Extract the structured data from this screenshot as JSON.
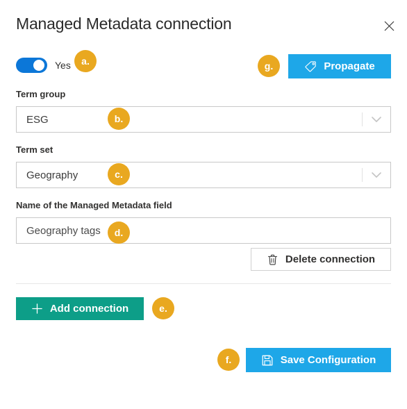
{
  "header": {
    "title": "Managed Metadata connection",
    "close_icon": "close-icon"
  },
  "enabled_toggle": {
    "label": "Yes",
    "state": "on",
    "accent_color": "#0c77d8"
  },
  "propagate_button": {
    "label": "Propagate",
    "icon": "tag-icon",
    "color": "#1ea7e8"
  },
  "fields": {
    "term_group": {
      "label": "Term group",
      "value": "ESG",
      "chevron_icon": "chevron-down-icon"
    },
    "term_set": {
      "label": "Term set",
      "value": "Geography",
      "chevron_icon": "chevron-down-icon"
    },
    "field_name": {
      "label": "Name of the Managed Metadata field",
      "value": "Geography tags",
      "placeholder": "Geography tags"
    }
  },
  "delete_button": {
    "label": "Delete connection",
    "icon": "trash-icon"
  },
  "add_button": {
    "label": "Add connection",
    "icon": "plus-icon",
    "color": "#0d9e88"
  },
  "save_button": {
    "label": "Save Configuration",
    "icon": "save-floppy-icon",
    "color": "#1ea7e8"
  },
  "annotations": {
    "badge_color": "#e9a820",
    "items": [
      {
        "id": "a",
        "label": "a.",
        "target": "enabled-toggle"
      },
      {
        "id": "b",
        "label": "b.",
        "target": "term-group-select"
      },
      {
        "id": "c",
        "label": "c.",
        "target": "term-set-select"
      },
      {
        "id": "d",
        "label": "d.",
        "target": "field-name-input"
      },
      {
        "id": "e",
        "label": "e.",
        "target": "add-connection-button"
      },
      {
        "id": "f",
        "label": "f.",
        "target": "save-configuration-button"
      },
      {
        "id": "g",
        "label": "g.",
        "target": "propagate-button"
      }
    ]
  }
}
